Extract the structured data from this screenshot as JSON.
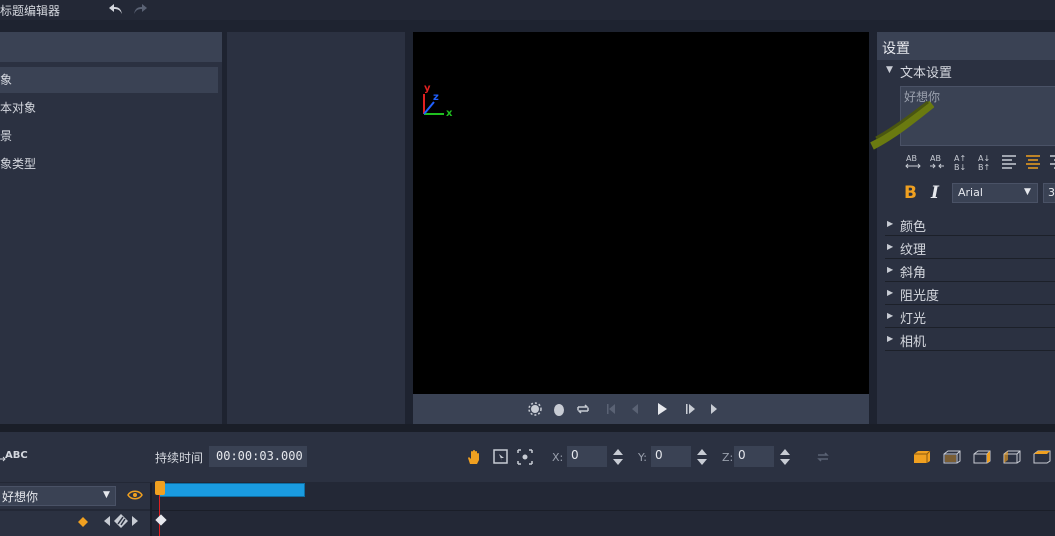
{
  "app": {
    "title": "标题编辑器"
  },
  "objects_panel": {
    "items": [
      {
        "label": "象",
        "selected": true
      },
      {
        "label": "本对象",
        "selected": false
      },
      {
        "label": "景",
        "selected": false
      },
      {
        "label": "象类型",
        "selected": false
      }
    ]
  },
  "preview": {
    "axes": {
      "x": "x",
      "y": "y",
      "z": "z"
    }
  },
  "settings": {
    "title": "设置",
    "text_settings": {
      "label": "文本设置",
      "text_value": "好想你",
      "bold_label": "B",
      "italic_label": "I",
      "font_value": "Arial",
      "size_value": "3",
      "format_buttons": [
        "AB↔",
        "AB→←",
        "A↑B↓",
        "A↓B↑",
        "align-left",
        "align-center",
        "align-right"
      ]
    },
    "sections": [
      "颜色",
      "纹理",
      "斜角",
      "阻光度",
      "灯光",
      "相机"
    ]
  },
  "timeline": {
    "abc_label": "ABC",
    "duration_label": "持续时间",
    "duration_value": "00:00:03.000",
    "x_label": "X:",
    "x_value": "0",
    "y_label": "Y:",
    "y_value": "0",
    "z_label": "Z:",
    "z_value": "0",
    "track_name": "好想你"
  },
  "colors": {
    "accent": "#f0a020",
    "clip": "#1a9be0",
    "playhead": "#e02020",
    "axis_x": "#20c020",
    "axis_y": "#e02020",
    "axis_z": "#2060ff"
  }
}
